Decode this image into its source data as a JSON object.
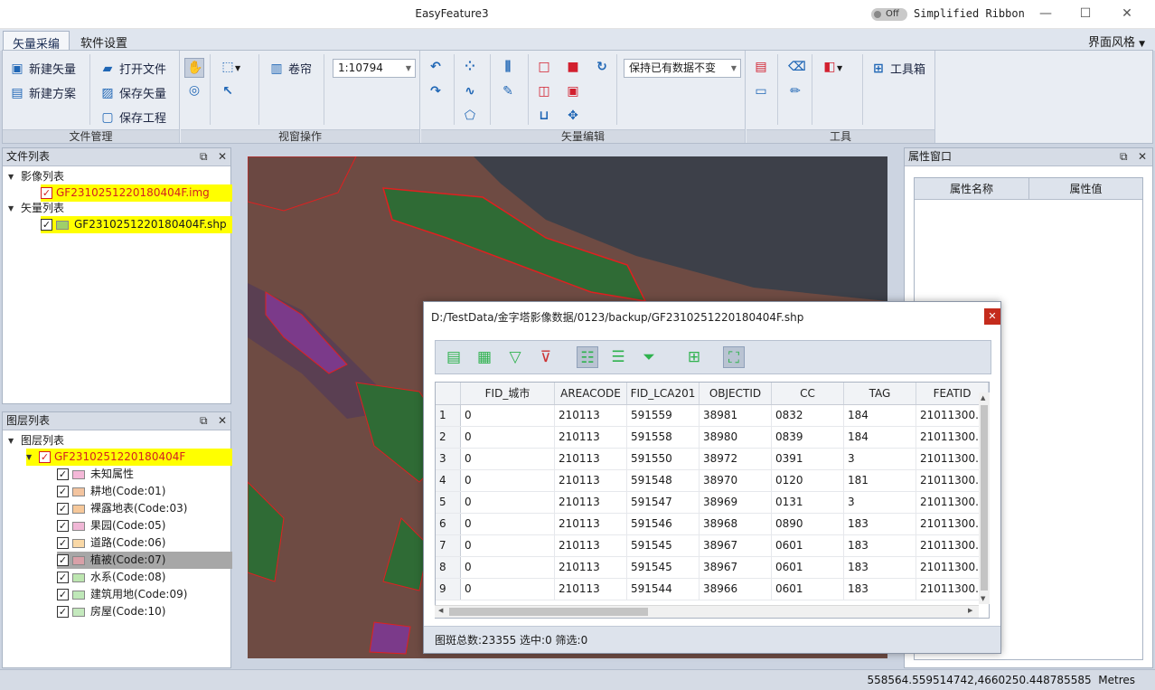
{
  "window": {
    "title": "EasyFeature3",
    "toggle_state": "Off",
    "ribbon_mode_label": "Simplified Ribbon",
    "theme_menu": "界面风格"
  },
  "ribbon_tabs": [
    "矢量采编",
    "软件设置"
  ],
  "ribbon": {
    "file_group": {
      "label": "文件管理",
      "new_vector": "新建矢量",
      "new_scheme": "新建方案",
      "open_file": "打开文件",
      "save_vector": "保存矢量",
      "save_project": "保存工程"
    },
    "view_group": {
      "label": "视窗操作",
      "curtain": "卷帘",
      "scale_value": "1:10794"
    },
    "edit_group": {
      "label": "矢量编辑",
      "data_mode_value": "保持已有数据不变"
    },
    "tools_group": {
      "label": "工具",
      "toolbox": "工具箱"
    }
  },
  "file_panel": {
    "title": "文件列表",
    "image_list_label": "影像列表",
    "image_file": "GF2310251220180404F.img",
    "vector_list_label": "矢量列表",
    "vector_file": "GF2310251220180404F.shp"
  },
  "layer_panel": {
    "title": "图层列表",
    "root_label": "图层列表",
    "layer_name": "GF2310251220180404F",
    "classes": [
      {
        "label": "未知属性",
        "color": "#f4b8d8"
      },
      {
        "label": "耕地(Code:01)",
        "color": "#f3c49f"
      },
      {
        "label": "裸露地表(Code:03)",
        "color": "#f6c89a"
      },
      {
        "label": "果园(Code:05)",
        "color": "#f0b7d6"
      },
      {
        "label": "道路(Code:06)",
        "color": "#f9d8a6"
      },
      {
        "label": "植被(Code:07)",
        "color": "#d9a0a8"
      },
      {
        "label": "水系(Code:08)",
        "color": "#bde6b0"
      },
      {
        "label": "建筑用地(Code:09)",
        "color": "#bfe8b8"
      },
      {
        "label": "房屋(Code:10)",
        "color": "#c4e9bd"
      }
    ]
  },
  "properties_panel": {
    "title": "属性窗口",
    "col_name": "属性名称",
    "col_value": "属性值"
  },
  "attribute_dialog": {
    "title": "D:/TestData/金字塔影像数据/0123/backup/GF2310251220180404F.shp",
    "columns": [
      "FID_城市",
      "AREACODE",
      "FID_LCA201",
      "OBJECTID",
      "CC",
      "TAG",
      "FEATID"
    ],
    "rows": [
      [
        "1",
        "0",
        "210113",
        "591559",
        "38981",
        "0832",
        "184",
        "21011300..."
      ],
      [
        "2",
        "0",
        "210113",
        "591558",
        "38980",
        "0839",
        "184",
        "21011300..."
      ],
      [
        "3",
        "0",
        "210113",
        "591550",
        "38972",
        "0391",
        "3",
        "21011300..."
      ],
      [
        "4",
        "0",
        "210113",
        "591548",
        "38970",
        "0120",
        "181",
        "21011300..."
      ],
      [
        "5",
        "0",
        "210113",
        "591547",
        "38969",
        "0131",
        "3",
        "21011300..."
      ],
      [
        "6",
        "0",
        "210113",
        "591546",
        "38968",
        "0890",
        "183",
        "21011300..."
      ],
      [
        "7",
        "0",
        "210113",
        "591545",
        "38967",
        "0601",
        "183",
        "21011300..."
      ],
      [
        "8",
        "0",
        "210113",
        "591545",
        "38967",
        "0601",
        "183",
        "21011300..."
      ],
      [
        "9",
        "0",
        "210113",
        "591544",
        "38966",
        "0601",
        "183",
        "21011300..."
      ]
    ],
    "status": "图斑总数:23355 选中:0 筛选:0"
  },
  "status_bar": {
    "coordinates": "558564.559514742,4660250.448785585",
    "units": "Metres"
  }
}
